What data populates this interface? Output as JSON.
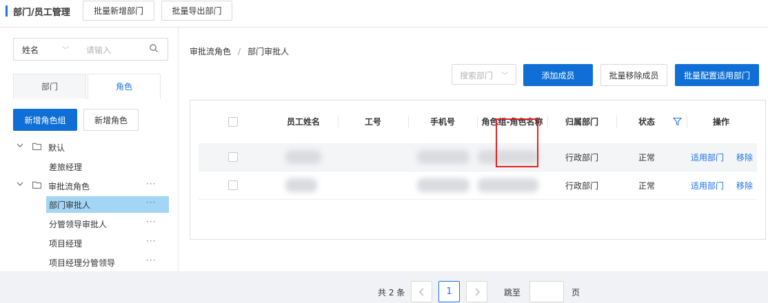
{
  "header": {
    "title": "部门/员工管理",
    "buttons": [
      "批量新增部门",
      "批量导出部门"
    ]
  },
  "left": {
    "search": {
      "field": "姓名",
      "placeholder": "请输入"
    },
    "tabs": [
      "部门",
      "角色"
    ],
    "active_tab": "角色",
    "buttons": [
      "新增角色组",
      "新增角色"
    ],
    "tree": [
      {
        "label": "默认",
        "type": "group"
      },
      {
        "label": "差旅经理",
        "type": "item"
      },
      {
        "label": "审批流角色",
        "type": "group"
      },
      {
        "label": "部门审批人",
        "type": "item",
        "selected": true
      },
      {
        "label": "分管领导审批人",
        "type": "item"
      },
      {
        "label": "项目经理",
        "type": "item"
      },
      {
        "label": "项目经理分管领导",
        "type": "item"
      }
    ],
    "more_glyph": "···"
  },
  "main": {
    "breadcrumb": [
      "审批流角色",
      "部门审批人"
    ],
    "breadcrumb_sep": "/",
    "dept_search_placeholder": "搜索部门",
    "buttons": {
      "add": "添加成员",
      "remove": "批量移除成员",
      "config": "批量配置适用部门"
    },
    "table": {
      "columns": [
        "员工姓名",
        "工号",
        "手机号",
        "角色组-角色名称",
        "归属部门",
        "状态",
        "操作"
      ],
      "rows": [
        {
          "dept": "行政部门",
          "status": "正常",
          "action_apply": "适用部门",
          "action_remove": "移除"
        },
        {
          "dept": "行政部门",
          "status": "正常",
          "action_apply": "适用部门",
          "action_remove": "移除"
        }
      ]
    },
    "pagination": {
      "total": "共 2 条",
      "current_page": "1",
      "jump_label": "跳至",
      "page_unit": "页"
    }
  },
  "colors": {
    "primary": "#0f6fd6",
    "link": "#1a73e8",
    "selected_bg": "#a3d6f5",
    "highlight_box": "#e02020"
  },
  "icons": [
    "search-icon",
    "chevron-down-icon",
    "folder-icon",
    "filter-icon",
    "chevron-left-icon",
    "chevron-right-icon",
    "more-icon"
  ]
}
